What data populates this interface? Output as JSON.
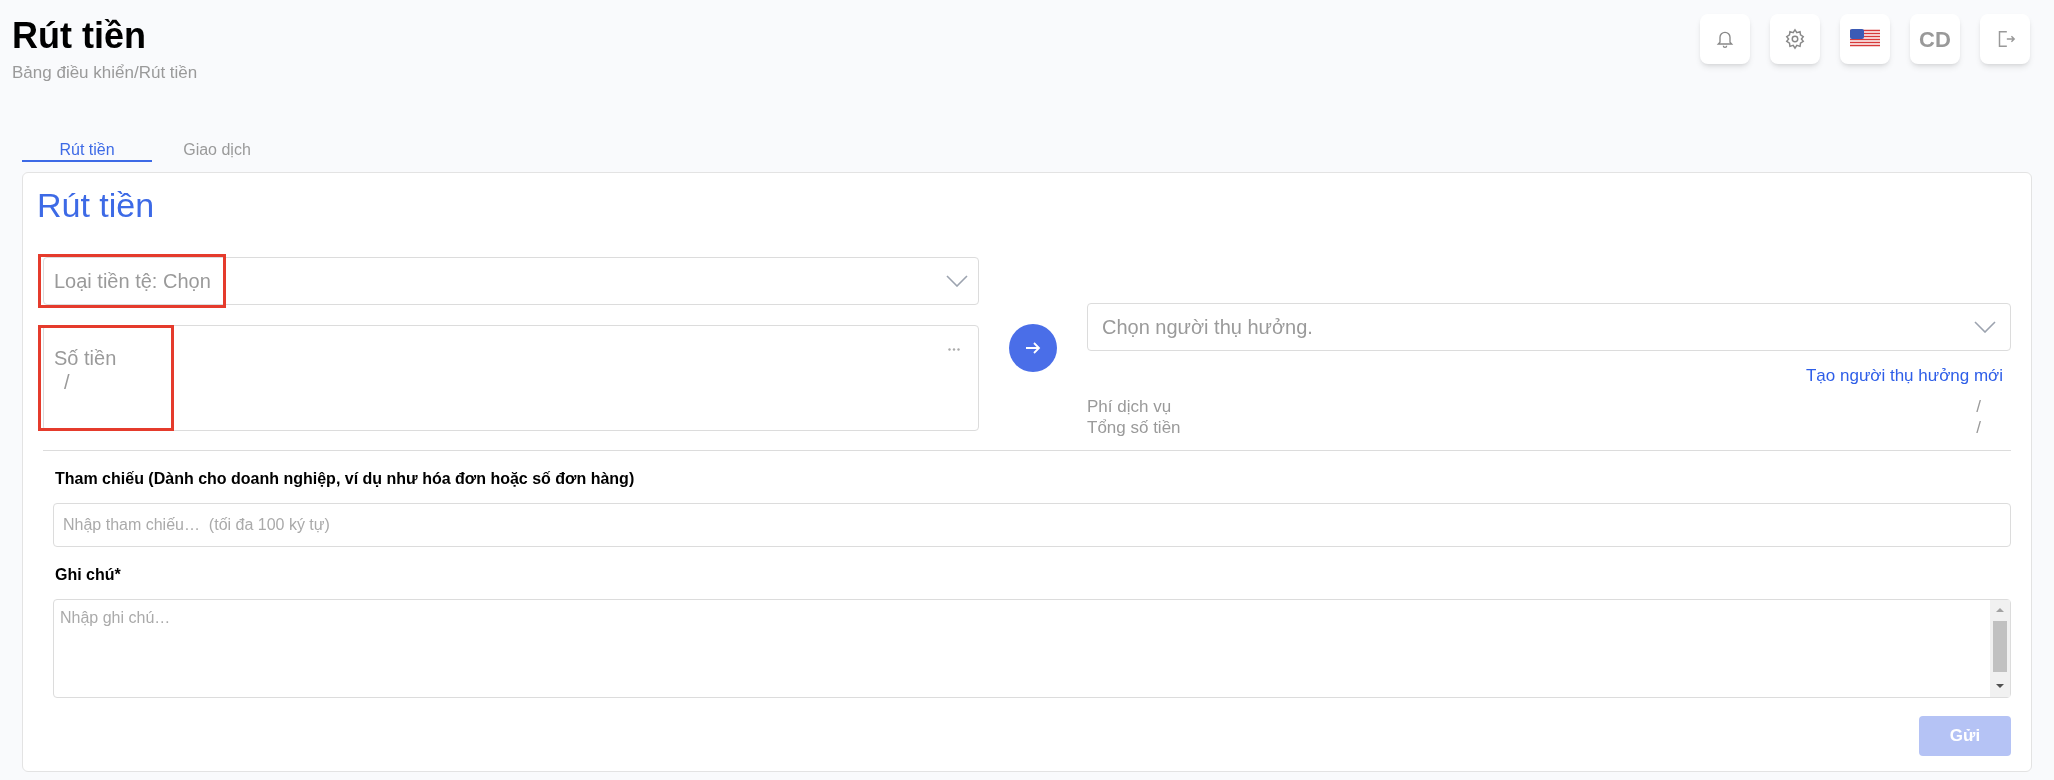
{
  "header": {
    "title": "Rút tiền",
    "breadcrumb": "Bảng điều khiển/Rút tiền",
    "user_initials": "CD"
  },
  "tabs": [
    {
      "label": "Rút tiền",
      "selected": true
    },
    {
      "label": "Giao dịch",
      "selected": false
    }
  ],
  "card": {
    "title": "Rút tiền",
    "currency_select": {
      "placeholder": "Loại tiền tệ: Chọn"
    },
    "amount": {
      "label": "Số tiền",
      "value": "/"
    },
    "beneficiary_select": {
      "placeholder": "Chọn người thụ hưởng."
    },
    "create_beneficiary_link": "Tạo người thụ hưởng mới",
    "summary": [
      {
        "label": "Phí dịch vụ",
        "value": "/"
      },
      {
        "label": "Tổng số tiền",
        "value": "/"
      }
    ],
    "reference": {
      "label": "Tham chiếu (Dành cho doanh nghiệp, ví dụ như hóa đơn hoặc số đơn hàng)",
      "placeholder": "Nhập tham chiếu…  (tối đa 100 ký tự)"
    },
    "note": {
      "label": "Ghi chú*",
      "placeholder": "Nhập ghi chú…"
    },
    "submit": {
      "label": "Gửi",
      "disabled": true
    }
  }
}
